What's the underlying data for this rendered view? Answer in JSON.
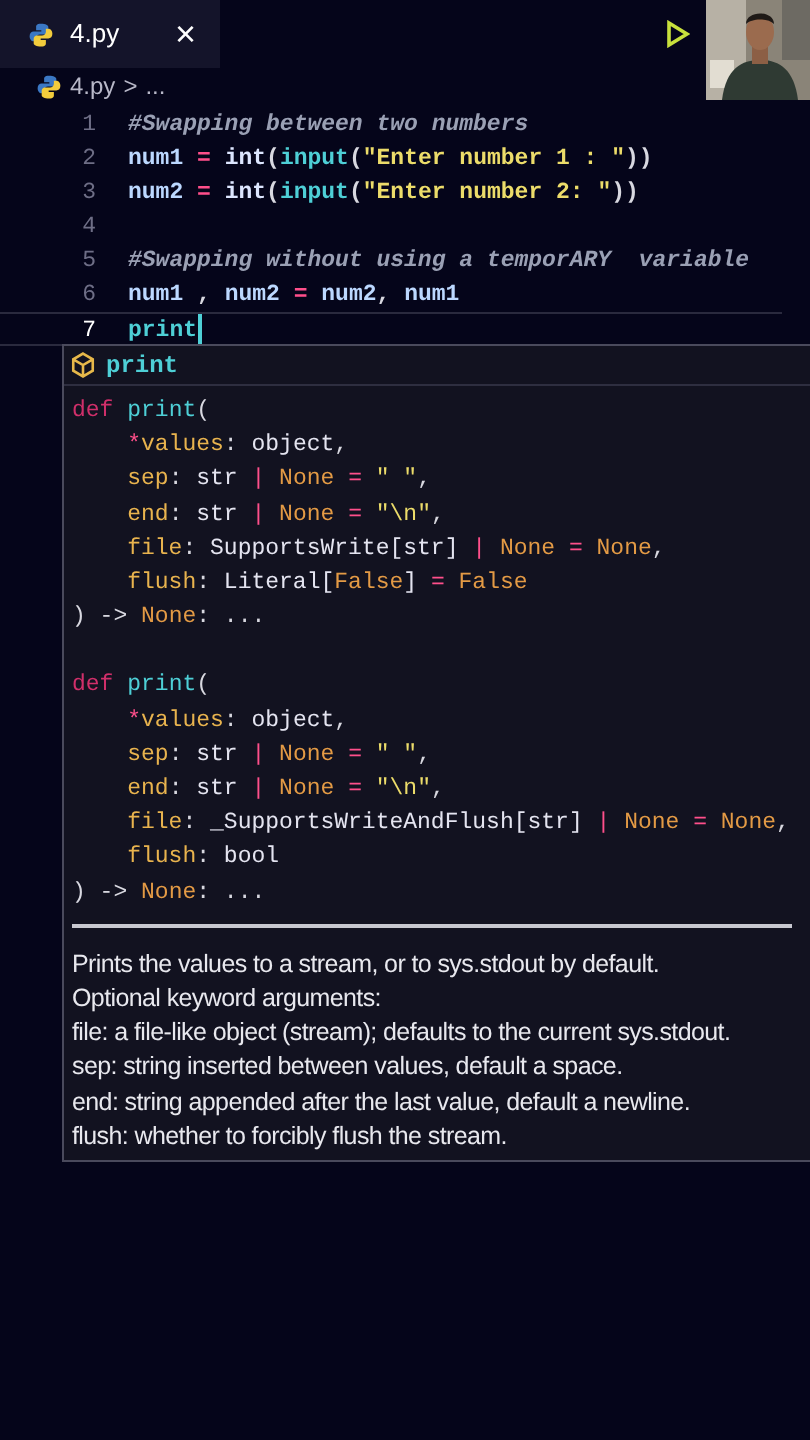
{
  "tab": {
    "label": "4.py",
    "close": "×",
    "selected": true
  },
  "breadcrumb": {
    "file": "4.py",
    "separator": ">",
    "rest": "..."
  },
  "lines": [
    {
      "number": "1",
      "selected": false,
      "tokens": [
        {
          "kind": "comment",
          "text": "#Swapping between two numbers"
        }
      ]
    },
    {
      "number": "2",
      "selected": false,
      "tokens": [
        {
          "kind": "var",
          "text": "num1 "
        },
        {
          "kind": "op",
          "text": "= "
        },
        {
          "kind": "builtin",
          "text": "int"
        },
        {
          "kind": "punct",
          "text": "("
        },
        {
          "kind": "fn",
          "text": "input"
        },
        {
          "kind": "punct",
          "text": "("
        },
        {
          "kind": "str",
          "text": "\"Enter number 1 : \""
        },
        {
          "kind": "punct",
          "text": "))"
        }
      ]
    },
    {
      "number": "3",
      "selected": false,
      "tokens": [
        {
          "kind": "var",
          "text": "num2 "
        },
        {
          "kind": "op",
          "text": "= "
        },
        {
          "kind": "builtin",
          "text": "int"
        },
        {
          "kind": "punct",
          "text": "("
        },
        {
          "kind": "fn",
          "text": "input"
        },
        {
          "kind": "punct",
          "text": "("
        },
        {
          "kind": "str",
          "text": "\"Enter number 2: \""
        },
        {
          "kind": "punct",
          "text": "))"
        }
      ]
    },
    {
      "number": "4",
      "selected": false
    },
    {
      "number": "5",
      "selected": false,
      "tokens": [
        {
          "kind": "comment",
          "text": "#Swapping without using a temporARY  variable"
        }
      ]
    },
    {
      "number": "6",
      "selected": false,
      "tokens": [
        {
          "kind": "var",
          "text": "num1"
        },
        {
          "kind": "punct",
          "text": " , "
        },
        {
          "kind": "var",
          "text": "num2 "
        },
        {
          "kind": "op",
          "text": "= "
        },
        {
          "kind": "var",
          "text": "num2"
        },
        {
          "kind": "punct",
          "text": ", "
        },
        {
          "kind": "var",
          "text": "num1"
        }
      ]
    },
    {
      "number": "7",
      "selected": true,
      "tokens": [
        {
          "kind": "fn",
          "text": "print"
        }
      ]
    }
  ],
  "suggestion": {
    "label": "print",
    "signatures": [
      [
        {
          "indented": false,
          "tokens": [
            {
              "kind": "kw",
              "text": "def "
            },
            {
              "kind": "fn",
              "text": "print"
            },
            {
              "kind": "punct",
              "text": "("
            }
          ]
        },
        {
          "indented": true,
          "tokens": [
            {
              "kind": "op",
              "text": "*"
            },
            {
              "kind": "param",
              "text": "values"
            },
            {
              "kind": "punct",
              "text": ": "
            },
            {
              "kind": "type",
              "text": "object"
            },
            {
              "kind": "punct",
              "text": ","
            }
          ]
        },
        {
          "indented": true,
          "tokens": [
            {
              "kind": "param",
              "text": "sep"
            },
            {
              "kind": "punct",
              "text": ": "
            },
            {
              "kind": "type",
              "text": "str "
            },
            {
              "kind": "op",
              "text": "| "
            },
            {
              "kind": "const",
              "text": "None "
            },
            {
              "kind": "op",
              "text": "= "
            },
            {
              "kind": "str",
              "text": "\" \""
            },
            {
              "kind": "punct",
              "text": ","
            }
          ]
        },
        {
          "indented": true,
          "tokens": [
            {
              "kind": "param",
              "text": "end"
            },
            {
              "kind": "punct",
              "text": ": "
            },
            {
              "kind": "type",
              "text": "str "
            },
            {
              "kind": "op",
              "text": "| "
            },
            {
              "kind": "const",
              "text": "None "
            },
            {
              "kind": "op",
              "text": "= "
            },
            {
              "kind": "str",
              "text": "\"\\n\""
            },
            {
              "kind": "punct",
              "text": ","
            }
          ]
        },
        {
          "indented": true,
          "tokens": [
            {
              "kind": "param",
              "text": "file"
            },
            {
              "kind": "punct",
              "text": ": "
            },
            {
              "kind": "type",
              "text": "SupportsWrite[str] "
            },
            {
              "kind": "op",
              "text": "| "
            },
            {
              "kind": "const",
              "text": "None "
            },
            {
              "kind": "op",
              "text": "= "
            },
            {
              "kind": "const",
              "text": "None"
            },
            {
              "kind": "punct",
              "text": ","
            }
          ]
        },
        {
          "indented": true,
          "tokens": [
            {
              "kind": "param",
              "text": "flush"
            },
            {
              "kind": "punct",
              "text": ": "
            },
            {
              "kind": "type",
              "text": "Literal["
            },
            {
              "kind": "const",
              "text": "False"
            },
            {
              "kind": "type",
              "text": "] "
            },
            {
              "kind": "op",
              "text": "= "
            },
            {
              "kind": "const",
              "text": "False"
            }
          ]
        },
        {
          "indented": false,
          "tokens": [
            {
              "kind": "punct",
              "text": ") -> "
            },
            {
              "kind": "const",
              "text": "None"
            },
            {
              "kind": "punct",
              "text": ": ..."
            }
          ]
        }
      ],
      [
        {
          "indented": false,
          "tokens": [
            {
              "kind": "kw",
              "text": "def "
            },
            {
              "kind": "fn",
              "text": "print"
            },
            {
              "kind": "punct",
              "text": "("
            }
          ]
        },
        {
          "indented": true,
          "tokens": [
            {
              "kind": "op",
              "text": "*"
            },
            {
              "kind": "param",
              "text": "values"
            },
            {
              "kind": "punct",
              "text": ": "
            },
            {
              "kind": "type",
              "text": "object"
            },
            {
              "kind": "punct",
              "text": ","
            }
          ]
        },
        {
          "indented": true,
          "tokens": [
            {
              "kind": "param",
              "text": "sep"
            },
            {
              "kind": "punct",
              "text": ": "
            },
            {
              "kind": "type",
              "text": "str "
            },
            {
              "kind": "op",
              "text": "| "
            },
            {
              "kind": "const",
              "text": "None "
            },
            {
              "kind": "op",
              "text": "= "
            },
            {
              "kind": "str",
              "text": "\" \""
            },
            {
              "kind": "punct",
              "text": ","
            }
          ]
        },
        {
          "indented": true,
          "tokens": [
            {
              "kind": "param",
              "text": "end"
            },
            {
              "kind": "punct",
              "text": ": "
            },
            {
              "kind": "type",
              "text": "str "
            },
            {
              "kind": "op",
              "text": "| "
            },
            {
              "kind": "const",
              "text": "None "
            },
            {
              "kind": "op",
              "text": "= "
            },
            {
              "kind": "str",
              "text": "\"\\n\""
            },
            {
              "kind": "punct",
              "text": ","
            }
          ]
        },
        {
          "indented": true,
          "tokens": [
            {
              "kind": "param",
              "text": "file"
            },
            {
              "kind": "punct",
              "text": ": "
            },
            {
              "kind": "type",
              "text": "_SupportsWriteAndFlush[str] "
            },
            {
              "kind": "op",
              "text": "| "
            },
            {
              "kind": "const",
              "text": "None "
            },
            {
              "kind": "op",
              "text": "= "
            },
            {
              "kind": "const",
              "text": "None"
            },
            {
              "kind": "punct",
              "text": ","
            }
          ]
        },
        {
          "indented": true,
          "tokens": [
            {
              "kind": "param",
              "text": "flush"
            },
            {
              "kind": "punct",
              "text": ": "
            },
            {
              "kind": "type",
              "text": "bool"
            }
          ]
        },
        {
          "indented": false,
          "tokens": [
            {
              "kind": "punct",
              "text": ") -> "
            },
            {
              "kind": "const",
              "text": "None"
            },
            {
              "kind": "punct",
              "text": ": ..."
            }
          ]
        }
      ]
    ],
    "description": [
      "Prints the values to a stream, or to sys.stdout by default.",
      "Optional keyword arguments:",
      "file: a file-like object (stream); defaults to the current sys.stdout.",
      "sep: string inserted between values, default a space.",
      "end: string appended after the last value, default a newline.",
      "flush: whether to forcibly flush the stream."
    ]
  }
}
